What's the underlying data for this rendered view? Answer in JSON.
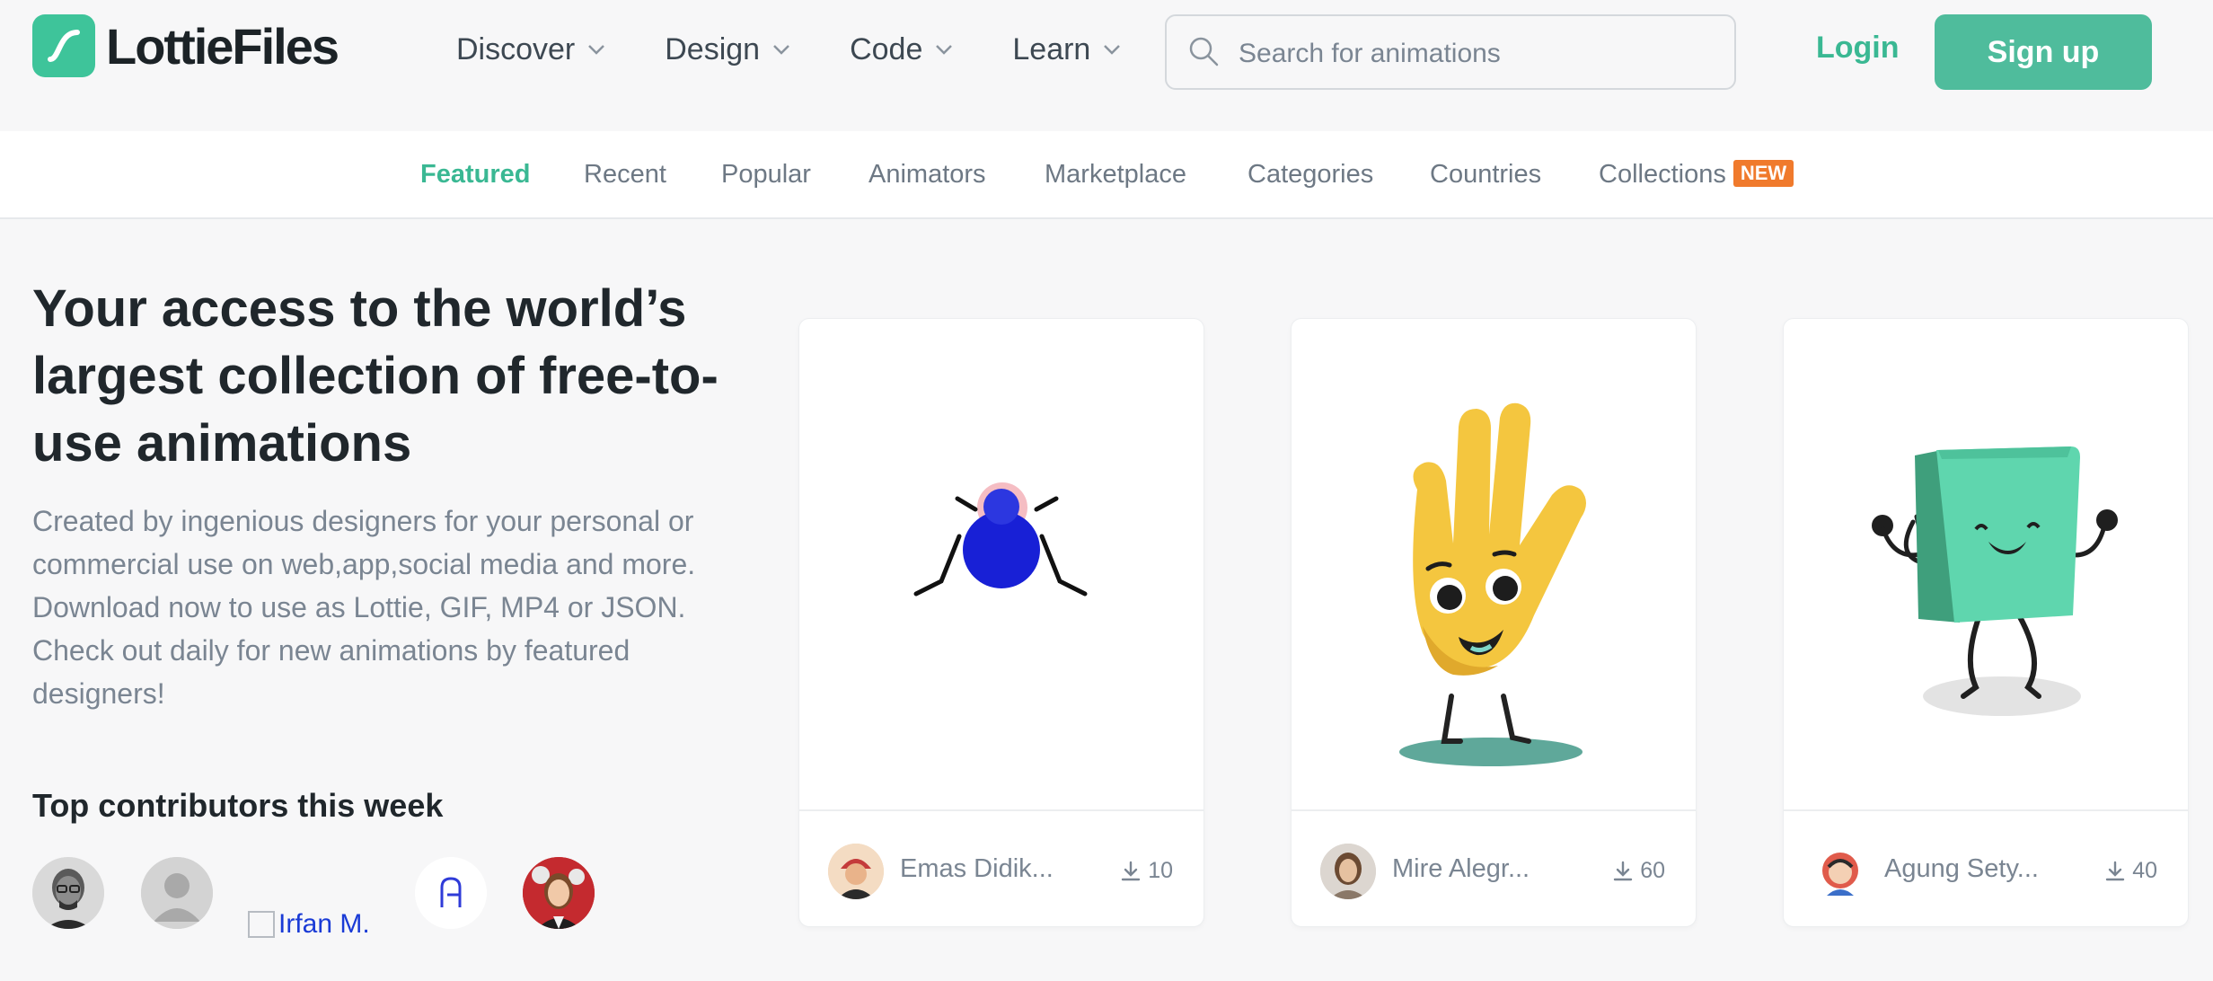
{
  "brand": {
    "name": "LottieFiles",
    "accent": "#3ec49a"
  },
  "nav": [
    {
      "label": "Discover"
    },
    {
      "label": "Design"
    },
    {
      "label": "Code"
    },
    {
      "label": "Learn"
    }
  ],
  "search": {
    "placeholder": "Search for animations",
    "value": ""
  },
  "auth": {
    "login": "Login",
    "signup": "Sign up"
  },
  "subnav": {
    "items": [
      {
        "label": "Featured",
        "active": true
      },
      {
        "label": "Recent"
      },
      {
        "label": "Popular"
      },
      {
        "label": "Animators"
      },
      {
        "label": "Marketplace"
      },
      {
        "label": "Categories"
      },
      {
        "label": "Countries"
      },
      {
        "label": "Collections"
      }
    ],
    "new_badge": "NEW"
  },
  "hero": {
    "title": "Your access to the world’s largest collection of free-to-use animations",
    "description": "Created by ingenious designers for your personal or commercial use on web,app,social media and more. Download now to use as Lottie, GIF, MP4 or JSON. Check out daily for new animations by featured designers!"
  },
  "contributors": {
    "title": "Top contributors this week",
    "broken_alt": "Irfan M."
  },
  "cards": [
    {
      "author": "Emas Didik...",
      "downloads": "10"
    },
    {
      "author": "Mire Alegr...",
      "downloads": "60"
    },
    {
      "author": "Agung Sety...",
      "downloads": "40"
    }
  ]
}
